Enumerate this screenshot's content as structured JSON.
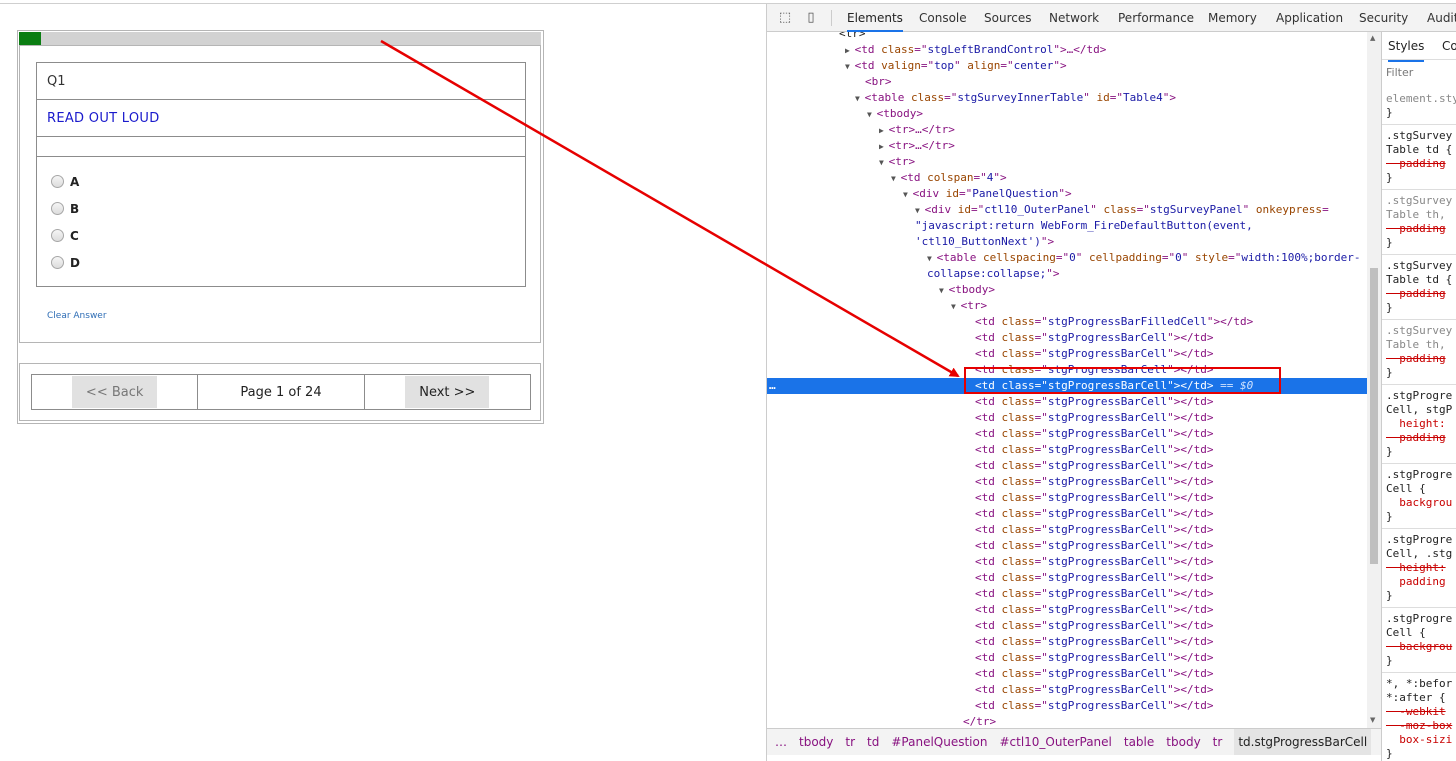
{
  "survey": {
    "progress": {
      "filled_cells": 1,
      "total_cells": 24
    },
    "question_number": "Q1",
    "question_text": "READ OUT LOUD",
    "options": [
      "A",
      "B",
      "C",
      "D"
    ],
    "clear_answer": "Clear Answer",
    "nav": {
      "back": "<< Back",
      "page": "Page 1 of 24",
      "next": "Next >>"
    }
  },
  "devtools": {
    "tabs": [
      "Elements",
      "Console",
      "Sources",
      "Network",
      "Performance",
      "Memory",
      "Application",
      "Security",
      "Audit"
    ],
    "active_tab": "Elements",
    "dom_lines": [
      [
        {
          "t": "tx",
          "v": "<tr>"
        }
      ],
      [
        {
          "t": "tri",
          "v": "▶"
        },
        {
          "t": "tg",
          "v": "<td "
        },
        {
          "t": "an",
          "v": "class"
        },
        {
          "t": "tg",
          "v": "=\""
        },
        {
          "t": "av",
          "v": "stgLeftBrandControl"
        },
        {
          "t": "tg",
          "v": "\">…</td>"
        }
      ],
      [
        {
          "t": "tri",
          "v": "▼"
        },
        {
          "t": "tg",
          "v": "<td "
        },
        {
          "t": "an",
          "v": "valign"
        },
        {
          "t": "tg",
          "v": "=\""
        },
        {
          "t": "av",
          "v": "top"
        },
        {
          "t": "tg",
          "v": "\" "
        },
        {
          "t": "an",
          "v": "align"
        },
        {
          "t": "tg",
          "v": "=\""
        },
        {
          "t": "av",
          "v": "center"
        },
        {
          "t": "tg",
          "v": "\">"
        }
      ],
      [
        {
          "t": "tg",
          "v": "<br>"
        }
      ],
      [
        {
          "t": "tri",
          "v": "▼"
        },
        {
          "t": "tg",
          "v": "<table "
        },
        {
          "t": "an",
          "v": "class"
        },
        {
          "t": "tg",
          "v": "=\""
        },
        {
          "t": "av",
          "v": "stgSurveyInnerTable"
        },
        {
          "t": "tg",
          "v": "\" "
        },
        {
          "t": "an",
          "v": "id"
        },
        {
          "t": "tg",
          "v": "=\""
        },
        {
          "t": "av",
          "v": "Table4"
        },
        {
          "t": "tg",
          "v": "\">"
        }
      ],
      [
        {
          "t": "tri",
          "v": "▼"
        },
        {
          "t": "tg",
          "v": "<tbody>"
        }
      ],
      [
        {
          "t": "tri",
          "v": "▶"
        },
        {
          "t": "tg",
          "v": "<tr>…</tr>"
        }
      ],
      [
        {
          "t": "tri",
          "v": "▶"
        },
        {
          "t": "tg",
          "v": "<tr>…</tr>"
        }
      ],
      [
        {
          "t": "tri",
          "v": "▼"
        },
        {
          "t": "tg",
          "v": "<tr>"
        }
      ],
      [
        {
          "t": "tri",
          "v": "▼"
        },
        {
          "t": "tg",
          "v": "<td "
        },
        {
          "t": "an",
          "v": "colspan"
        },
        {
          "t": "tg",
          "v": "=\""
        },
        {
          "t": "av",
          "v": "4"
        },
        {
          "t": "tg",
          "v": "\">"
        }
      ],
      [
        {
          "t": "tri",
          "v": "▼"
        },
        {
          "t": "tg",
          "v": "<div "
        },
        {
          "t": "an",
          "v": "id"
        },
        {
          "t": "tg",
          "v": "=\""
        },
        {
          "t": "av",
          "v": "PanelQuestion"
        },
        {
          "t": "tg",
          "v": "\">"
        }
      ],
      [
        {
          "t": "tri",
          "v": "▼"
        },
        {
          "t": "tg",
          "v": "<div "
        },
        {
          "t": "an",
          "v": "id"
        },
        {
          "t": "tg",
          "v": "=\""
        },
        {
          "t": "av",
          "v": "ctl10_OuterPanel"
        },
        {
          "t": "tg",
          "v": "\" "
        },
        {
          "t": "an",
          "v": "class"
        },
        {
          "t": "tg",
          "v": "=\""
        },
        {
          "t": "av",
          "v": "stgSurveyPanel"
        },
        {
          "t": "tg",
          "v": "\" "
        },
        {
          "t": "an",
          "v": "onkeypress"
        },
        {
          "t": "tg",
          "v": "="
        }
      ],
      [
        {
          "t": "av",
          "v": "\"javascript:return WebForm_FireDefaultButton(event,"
        }
      ],
      [
        {
          "t": "av",
          "v": "'ctl10_ButtonNext')"
        },
        {
          "t": "tg",
          "v": "\">"
        }
      ],
      [
        {
          "t": "tri",
          "v": "▼"
        },
        {
          "t": "tg",
          "v": "<table "
        },
        {
          "t": "an",
          "v": "cellspacing"
        },
        {
          "t": "tg",
          "v": "=\""
        },
        {
          "t": "av",
          "v": "0"
        },
        {
          "t": "tg",
          "v": "\" "
        },
        {
          "t": "an",
          "v": "cellpadding"
        },
        {
          "t": "tg",
          "v": "=\""
        },
        {
          "t": "av",
          "v": "0"
        },
        {
          "t": "tg",
          "v": "\" "
        },
        {
          "t": "an",
          "v": "style"
        },
        {
          "t": "tg",
          "v": "=\""
        },
        {
          "t": "av",
          "v": "width:100%;border-"
        }
      ],
      [
        {
          "t": "av",
          "v": "collapse:collapse;"
        },
        {
          "t": "tg",
          "v": "\">"
        }
      ],
      [
        {
          "t": "tri",
          "v": "▼"
        },
        {
          "t": "tg",
          "v": "<tbody>"
        }
      ],
      [
        {
          "t": "tri",
          "v": "▼"
        },
        {
          "t": "tg",
          "v": "<tr>"
        }
      ],
      [
        {
          "t": "tg",
          "v": "<td "
        },
        {
          "t": "an",
          "v": "class"
        },
        {
          "t": "tg",
          "v": "=\""
        },
        {
          "t": "av",
          "v": "stgProgressBarFilledCell"
        },
        {
          "t": "tg",
          "v": "\"></td>"
        }
      ],
      [
        {
          "t": "tg",
          "v": "<td "
        },
        {
          "t": "an",
          "v": "class"
        },
        {
          "t": "tg",
          "v": "=\""
        },
        {
          "t": "av",
          "v": "stgProgressBarCell"
        },
        {
          "t": "tg",
          "v": "\"></td>"
        }
      ],
      [
        {
          "t": "tg",
          "v": "<td "
        },
        {
          "t": "an",
          "v": "class"
        },
        {
          "t": "tg",
          "v": "=\""
        },
        {
          "t": "av",
          "v": "stgProgressBarCell"
        },
        {
          "t": "tg",
          "v": "\"></td>"
        }
      ],
      [
        {
          "t": "tg",
          "v": "<td "
        },
        {
          "t": "an",
          "v": "class"
        },
        {
          "t": "tg",
          "v": "=\""
        },
        {
          "t": "av",
          "v": "stgProgressBarCell"
        },
        {
          "t": "tg",
          "v": "\"></td>"
        }
      ],
      [
        {
          "t": "tg",
          "v": "<td "
        },
        {
          "t": "an",
          "v": "class"
        },
        {
          "t": "tg",
          "v": "=\""
        },
        {
          "t": "av",
          "v": "stgProgressBarCell"
        },
        {
          "t": "tg",
          "v": "\"></td>"
        },
        {
          "t": "eq",
          "v": " == $0"
        }
      ],
      [
        {
          "t": "tg",
          "v": "<td "
        },
        {
          "t": "an",
          "v": "class"
        },
        {
          "t": "tg",
          "v": "=\""
        },
        {
          "t": "av",
          "v": "stgProgressBarCell"
        },
        {
          "t": "tg",
          "v": "\"></td>"
        }
      ],
      [
        {
          "t": "tg",
          "v": "<td "
        },
        {
          "t": "an",
          "v": "class"
        },
        {
          "t": "tg",
          "v": "=\""
        },
        {
          "t": "av",
          "v": "stgProgressBarCell"
        },
        {
          "t": "tg",
          "v": "\"></td>"
        }
      ],
      [
        {
          "t": "tg",
          "v": "<td "
        },
        {
          "t": "an",
          "v": "class"
        },
        {
          "t": "tg",
          "v": "=\""
        },
        {
          "t": "av",
          "v": "stgProgressBarCell"
        },
        {
          "t": "tg",
          "v": "\"></td>"
        }
      ],
      [
        {
          "t": "tg",
          "v": "<td "
        },
        {
          "t": "an",
          "v": "class"
        },
        {
          "t": "tg",
          "v": "=\""
        },
        {
          "t": "av",
          "v": "stgProgressBarCell"
        },
        {
          "t": "tg",
          "v": "\"></td>"
        }
      ],
      [
        {
          "t": "tg",
          "v": "<td "
        },
        {
          "t": "an",
          "v": "class"
        },
        {
          "t": "tg",
          "v": "=\""
        },
        {
          "t": "av",
          "v": "stgProgressBarCell"
        },
        {
          "t": "tg",
          "v": "\"></td>"
        }
      ],
      [
        {
          "t": "tg",
          "v": "<td "
        },
        {
          "t": "an",
          "v": "class"
        },
        {
          "t": "tg",
          "v": "=\""
        },
        {
          "t": "av",
          "v": "stgProgressBarCell"
        },
        {
          "t": "tg",
          "v": "\"></td>"
        }
      ],
      [
        {
          "t": "tg",
          "v": "<td "
        },
        {
          "t": "an",
          "v": "class"
        },
        {
          "t": "tg",
          "v": "=\""
        },
        {
          "t": "av",
          "v": "stgProgressBarCell"
        },
        {
          "t": "tg",
          "v": "\"></td>"
        }
      ],
      [
        {
          "t": "tg",
          "v": "<td "
        },
        {
          "t": "an",
          "v": "class"
        },
        {
          "t": "tg",
          "v": "=\""
        },
        {
          "t": "av",
          "v": "stgProgressBarCell"
        },
        {
          "t": "tg",
          "v": "\"></td>"
        }
      ],
      [
        {
          "t": "tg",
          "v": "<td "
        },
        {
          "t": "an",
          "v": "class"
        },
        {
          "t": "tg",
          "v": "=\""
        },
        {
          "t": "av",
          "v": "stgProgressBarCell"
        },
        {
          "t": "tg",
          "v": "\"></td>"
        }
      ],
      [
        {
          "t": "tg",
          "v": "<td "
        },
        {
          "t": "an",
          "v": "class"
        },
        {
          "t": "tg",
          "v": "=\""
        },
        {
          "t": "av",
          "v": "stgProgressBarCell"
        },
        {
          "t": "tg",
          "v": "\"></td>"
        }
      ],
      [
        {
          "t": "tg",
          "v": "<td "
        },
        {
          "t": "an",
          "v": "class"
        },
        {
          "t": "tg",
          "v": "=\""
        },
        {
          "t": "av",
          "v": "stgProgressBarCell"
        },
        {
          "t": "tg",
          "v": "\"></td>"
        }
      ],
      [
        {
          "t": "tg",
          "v": "<td "
        },
        {
          "t": "an",
          "v": "class"
        },
        {
          "t": "tg",
          "v": "=\""
        },
        {
          "t": "av",
          "v": "stgProgressBarCell"
        },
        {
          "t": "tg",
          "v": "\"></td>"
        }
      ],
      [
        {
          "t": "tg",
          "v": "<td "
        },
        {
          "t": "an",
          "v": "class"
        },
        {
          "t": "tg",
          "v": "=\""
        },
        {
          "t": "av",
          "v": "stgProgressBarCell"
        },
        {
          "t": "tg",
          "v": "\"></td>"
        }
      ],
      [
        {
          "t": "tg",
          "v": "<td "
        },
        {
          "t": "an",
          "v": "class"
        },
        {
          "t": "tg",
          "v": "=\""
        },
        {
          "t": "av",
          "v": "stgProgressBarCell"
        },
        {
          "t": "tg",
          "v": "\"></td>"
        }
      ],
      [
        {
          "t": "tg",
          "v": "<td "
        },
        {
          "t": "an",
          "v": "class"
        },
        {
          "t": "tg",
          "v": "=\""
        },
        {
          "t": "av",
          "v": "stgProgressBarCell"
        },
        {
          "t": "tg",
          "v": "\"></td>"
        }
      ],
      [
        {
          "t": "tg",
          "v": "<td "
        },
        {
          "t": "an",
          "v": "class"
        },
        {
          "t": "tg",
          "v": "=\""
        },
        {
          "t": "av",
          "v": "stgProgressBarCell"
        },
        {
          "t": "tg",
          "v": "\"></td>"
        }
      ],
      [
        {
          "t": "tg",
          "v": "<td "
        },
        {
          "t": "an",
          "v": "class"
        },
        {
          "t": "tg",
          "v": "=\""
        },
        {
          "t": "av",
          "v": "stgProgressBarCell"
        },
        {
          "t": "tg",
          "v": "\"></td>"
        }
      ],
      [
        {
          "t": "tg",
          "v": "<td "
        },
        {
          "t": "an",
          "v": "class"
        },
        {
          "t": "tg",
          "v": "=\""
        },
        {
          "t": "av",
          "v": "stgProgressBarCell"
        },
        {
          "t": "tg",
          "v": "\"></td>"
        }
      ],
      [
        {
          "t": "tg",
          "v": "<td "
        },
        {
          "t": "an",
          "v": "class"
        },
        {
          "t": "tg",
          "v": "=\""
        },
        {
          "t": "av",
          "v": "stgProgressBarCell"
        },
        {
          "t": "tg",
          "v": "\"></td>"
        }
      ],
      [
        {
          "t": "tg",
          "v": "<td "
        },
        {
          "t": "an",
          "v": "class"
        },
        {
          "t": "tg",
          "v": "=\""
        },
        {
          "t": "av",
          "v": "stgProgressBarCell"
        },
        {
          "t": "tg",
          "v": "\"></td>"
        }
      ],
      [
        {
          "t": "tg",
          "v": "</tr>"
        }
      ],
      [
        {
          "t": "tg",
          "v": "</tbody>"
        }
      ]
    ],
    "selected_line": 22,
    "styles_tabs": [
      "Styles",
      "Co"
    ],
    "styles_filter": "Filter",
    "style_rules": [
      [
        {
          "t": "dim",
          "v": "element.sty"
        },
        {
          "t": "n",
          "v": "}"
        }
      ],
      [
        {
          "t": "n",
          "v": ".stgSurvey"
        },
        {
          "t": "n",
          "v": "Table td {"
        },
        {
          "t": "strike",
          "v": "  padding"
        },
        {
          "t": "n",
          "v": "}"
        }
      ],
      [
        {
          "t": "dim",
          "v": ".stgSurvey"
        },
        {
          "t": "dim",
          "v": "Table th,"
        },
        {
          "t": "strike",
          "v": "  padding"
        },
        {
          "t": "n",
          "v": "}"
        }
      ],
      [
        {
          "t": "n",
          "v": ".stgSurvey"
        },
        {
          "t": "n",
          "v": "Table td {"
        },
        {
          "t": "strike",
          "v": "  padding"
        },
        {
          "t": "n",
          "v": "}"
        }
      ],
      [
        {
          "t": "dim",
          "v": ".stgSurvey"
        },
        {
          "t": "dim",
          "v": "Table th,"
        },
        {
          "t": "strike",
          "v": "  padding"
        },
        {
          "t": "n",
          "v": "}"
        }
      ],
      [
        {
          "t": "n",
          "v": ".stgProgre"
        },
        {
          "t": "n",
          "v": "Cell, stgP"
        },
        {
          "t": "prop",
          "v": "  height:"
        },
        {
          "t": "strike",
          "v": "  padding"
        },
        {
          "t": "n",
          "v": "}"
        }
      ],
      [
        {
          "t": "n",
          "v": ".stgProgre"
        },
        {
          "t": "n",
          "v": "Cell {"
        },
        {
          "t": "prop",
          "v": "  backgrou"
        },
        {
          "t": "n",
          "v": "}"
        }
      ],
      [
        {
          "t": "n",
          "v": ".stgProgre"
        },
        {
          "t": "n",
          "v": "Cell, .stg"
        },
        {
          "t": "strike",
          "v": "  height:"
        },
        {
          "t": "prop",
          "v": "  padding"
        },
        {
          "t": "n",
          "v": "}"
        }
      ],
      [
        {
          "t": "n",
          "v": ".stgProgre"
        },
        {
          "t": "n",
          "v": "Cell {"
        },
        {
          "t": "strike",
          "v": "  backgrou"
        },
        {
          "t": "n",
          "v": "}"
        }
      ],
      [
        {
          "t": "n",
          "v": "*, *:befor"
        },
        {
          "t": "n",
          "v": "*:after {"
        },
        {
          "t": "strike",
          "v": "  -webkit"
        },
        {
          "t": "strike",
          "v": "  -moz-box"
        },
        {
          "t": "prop",
          "v": "  box-sizi"
        },
        {
          "t": "n",
          "v": "}"
        }
      ]
    ],
    "breadcrumbs": [
      "…",
      "tbody",
      "tr",
      "td",
      "#PanelQuestion",
      "#ctl10_OuterPanel",
      "table",
      "tbody",
      "tr",
      "td.stgProgressBarCell"
    ]
  },
  "colors": {
    "progress_fill": "#0a7d12",
    "question_text": "#1a1acc",
    "annotation": "#e60000",
    "selection": "#1a73e8"
  }
}
